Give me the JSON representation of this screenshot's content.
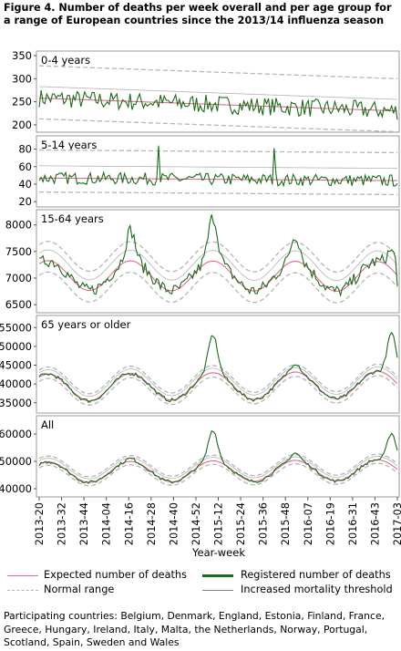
{
  "title": "Figure 4. Number of deaths per week overall and per age group for a range of European countries since the 2013/14 influenza season",
  "xlabel": "Year-week",
  "legend": [
    {
      "label": "Expected number of deaths",
      "color": "#e36a8f",
      "style": "solid"
    },
    {
      "label": "Registered number of deaths",
      "color": "#1a6b1a",
      "style": "solid-thick"
    },
    {
      "label": "Normal range",
      "color": "#b5b5b5",
      "style": "dashed"
    },
    {
      "label": "Increased mortality threshold",
      "color": "#808080",
      "style": "solid-thin"
    }
  ],
  "footnote": "Participating countries: Belgium, Denmark, England, Estonia, Finland, France, Greece, Hungary, Ireland, Italy, Malta, the Netherlands, Norway, Portugal, Scotland, Spain, Sweden and Wales",
  "colors": {
    "expected": "#e36a8f",
    "registered": "#1a6b1a",
    "normal_range": "#b5b5b5",
    "threshold": "#808080",
    "panel_border": "#9a9a9a",
    "gridline": "#e6e6e6"
  },
  "chart_data": [
    {
      "type": "line",
      "panel": "0-4 years",
      "ylim": [
        190,
        350
      ],
      "yticks": [
        200,
        250,
        300,
        350
      ],
      "seasonal": false,
      "base": 258,
      "trend": -28,
      "upper_offset": 70,
      "lower_offset": -45,
      "threshold_offset": 25,
      "noise": 20,
      "spikes": [],
      "x_ticks": [
        "2013-20",
        "2013-32",
        "2013-44",
        "2014-04",
        "2014-16",
        "2014-28",
        "2014-40",
        "2014-52",
        "2015-12",
        "2015-24",
        "2015-36",
        "2015-48",
        "2016-07",
        "2016-19",
        "2016-31",
        "2016-43",
        "2017-03"
      ]
    },
    {
      "type": "line",
      "panel": "5-14 years",
      "ylim": [
        17,
        90
      ],
      "yticks": [
        20,
        40,
        60,
        80
      ],
      "seasonal": false,
      "base": 47,
      "trend": -3,
      "upper_offset": 32,
      "lower_offset": -16,
      "threshold_offset": 14,
      "noise": 7,
      "spikes": [
        {
          "x": 0.335,
          "v": 84
        },
        {
          "x": 0.655,
          "v": 81
        }
      ]
    },
    {
      "type": "line",
      "panel": "15-64 years",
      "ylim": [
        6400,
        8200
      ],
      "yticks": [
        6500,
        7000,
        7500,
        8000
      ],
      "seasonal": true,
      "base": 7050,
      "amplitude": 280,
      "trend": -20,
      "band": 360,
      "threshold_offset": 200,
      "noise": 120,
      "peaks": [
        {
          "x": 0.255,
          "v": 7900
        },
        {
          "x": 0.485,
          "v": 8150
        },
        {
          "x": 0.715,
          "v": 7800
        },
        {
          "x": 0.985,
          "v": 7650
        }
      ],
      "end_value": 6850
    },
    {
      "type": "line",
      "panel": "65 years or older",
      "ylim": [
        33000,
        57000
      ],
      "yticks": [
        35000,
        40000,
        45000,
        50000,
        55000
      ],
      "seasonal": true,
      "base": 39000,
      "amplitude": 3600,
      "trend": 800,
      "band": 1900,
      "threshold_offset": 1200,
      "noise": 500,
      "peaks": [
        {
          "x": 0.255,
          "v": 42500
        },
        {
          "x": 0.485,
          "v": 53000
        },
        {
          "x": 0.715,
          "v": 45500
        },
        {
          "x": 0.985,
          "v": 55500
        }
      ],
      "end_value": 47000
    },
    {
      "type": "line",
      "panel": "All",
      "ylim": [
        38000,
        65000
      ],
      "yticks": [
        40000,
        50000,
        60000
      ],
      "seasonal": true,
      "base": 46000,
      "amplitude": 3800,
      "trend": 800,
      "band": 2100,
      "threshold_offset": 1300,
      "noise": 600,
      "peaks": [
        {
          "x": 0.255,
          "v": 51000
        },
        {
          "x": 0.485,
          "v": 61500
        },
        {
          "x": 0.715,
          "v": 53000
        },
        {
          "x": 0.985,
          "v": 62500
        }
      ],
      "end_value": 54000
    }
  ]
}
